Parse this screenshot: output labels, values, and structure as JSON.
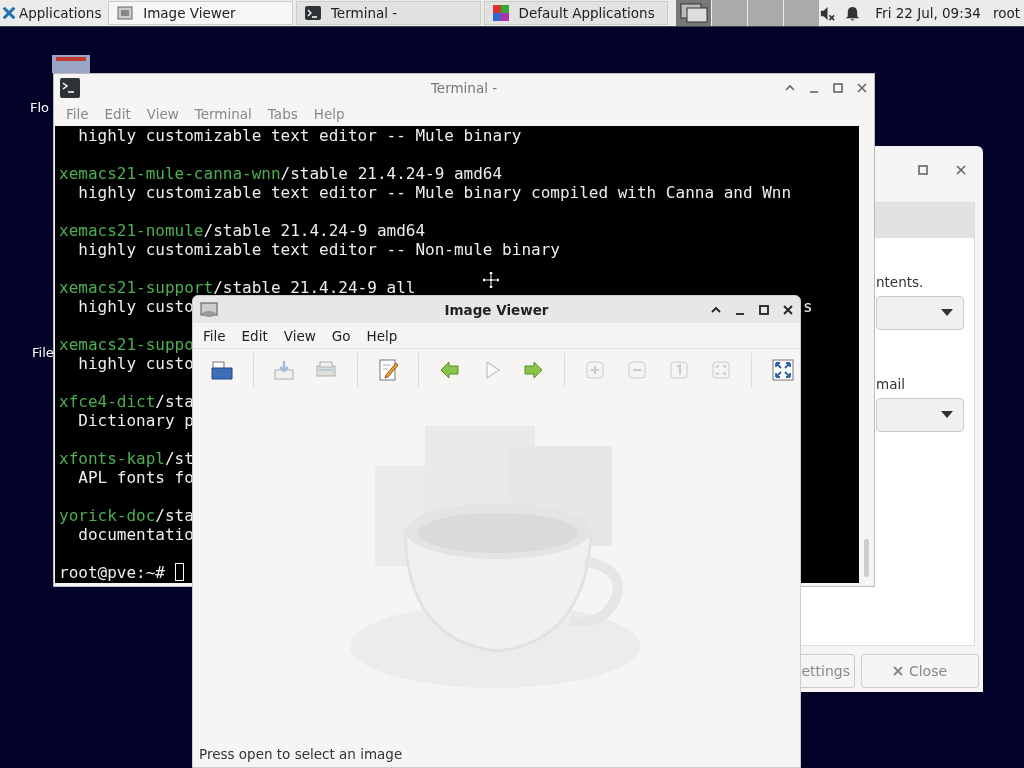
{
  "panel": {
    "applications": "Applications",
    "tasks": [
      {
        "kind": "viewer",
        "label": "Image Viewer",
        "selected": true
      },
      {
        "kind": "terminal",
        "label": "Terminal -",
        "selected": false
      },
      {
        "kind": "apps",
        "label": "Default Applications",
        "selected": false
      }
    ],
    "workspaces": [
      {
        "selected": true
      },
      {
        "selected": false
      },
      {
        "selected": false
      },
      {
        "selected": false
      }
    ],
    "volume_muted": true,
    "clock": "Fri 22 Jul, 09:34",
    "user": "root"
  },
  "desktop_icons": [
    {
      "kind": "floppy",
      "label": "Flo"
    },
    {
      "kind": "files",
      "label": "File"
    }
  ],
  "default_apps": {
    "text_1": "ntents.",
    "text_2": "mail",
    "buttons": [
      {
        "kind": "settings",
        "label": "ettings"
      },
      {
        "kind": "close",
        "label": "Close"
      }
    ]
  },
  "terminal": {
    "title": "Terminal -",
    "menu": [
      "File",
      "Edit",
      "View",
      "Terminal",
      "Tabs",
      "Help"
    ],
    "lines": [
      {
        "kind": "text",
        "text": "  highly customizable text editor -- Mule binary"
      },
      {
        "kind": "blank"
      },
      {
        "kind": "package",
        "package": "xemacs21-mule-canna-wnn",
        "text": "/stable 21.4.24-9 amd64"
      },
      {
        "kind": "text",
        "text": "  highly customizable text editor -- Mule binary compiled with Canna and Wnn"
      },
      {
        "kind": "blank"
      },
      {
        "kind": "package",
        "package": "xemacs21-nomule",
        "text": "/stable 21.4.24-9 amd64"
      },
      {
        "kind": "text",
        "text": "  highly customizable text editor -- Non-mule binary"
      },
      {
        "kind": "blank"
      },
      {
        "kind": "package",
        "package": "xemacs21-support",
        "text": "/stable 21.4.24-9 all"
      },
      {
        "kind": "text",
        "text": "  highly custo",
        "tail": "s"
      },
      {
        "kind": "blank"
      },
      {
        "kind": "package",
        "package": "xemacs21-suppo"
      },
      {
        "kind": "text",
        "text": "  highly custo"
      },
      {
        "kind": "blank"
      },
      {
        "kind": "package",
        "package": "xfce4-dict",
        "text": "/sta"
      },
      {
        "kind": "text",
        "text": "  Dictionary p"
      },
      {
        "kind": "blank"
      },
      {
        "kind": "package",
        "package": "xfonts-kapl",
        "text": "/st"
      },
      {
        "kind": "text",
        "text": "  APL fonts fo"
      },
      {
        "kind": "blank"
      },
      {
        "kind": "package",
        "package": "yorick-doc",
        "text": "/sta"
      },
      {
        "kind": "text",
        "text": "  documentatio"
      },
      {
        "kind": "blank"
      },
      {
        "kind": "prompt",
        "text": "root@pve:~# "
      }
    ]
  },
  "image_viewer": {
    "title": "Image Viewer",
    "menu": [
      "File",
      "Edit",
      "View",
      "Go",
      "Help"
    ],
    "toolbar": [
      {
        "kind": "open",
        "disabled": false
      },
      {
        "kind": "separator"
      },
      {
        "kind": "save",
        "disabled": true
      },
      {
        "kind": "print",
        "disabled": true
      },
      {
        "kind": "separator"
      },
      {
        "kind": "edit",
        "disabled": false
      },
      {
        "kind": "separator"
      },
      {
        "kind": "back",
        "disabled": false
      },
      {
        "kind": "play",
        "disabled": true
      },
      {
        "kind": "forward",
        "disabled": false
      },
      {
        "kind": "separator"
      },
      {
        "kind": "zoom-in",
        "disabled": true
      },
      {
        "kind": "zoom-out",
        "disabled": true
      },
      {
        "kind": "normal-size",
        "disabled": true
      },
      {
        "kind": "fit",
        "disabled": true
      },
      {
        "kind": "separator"
      },
      {
        "kind": "fullscreen",
        "disabled": false
      }
    ],
    "status": "Press open to select an image"
  }
}
